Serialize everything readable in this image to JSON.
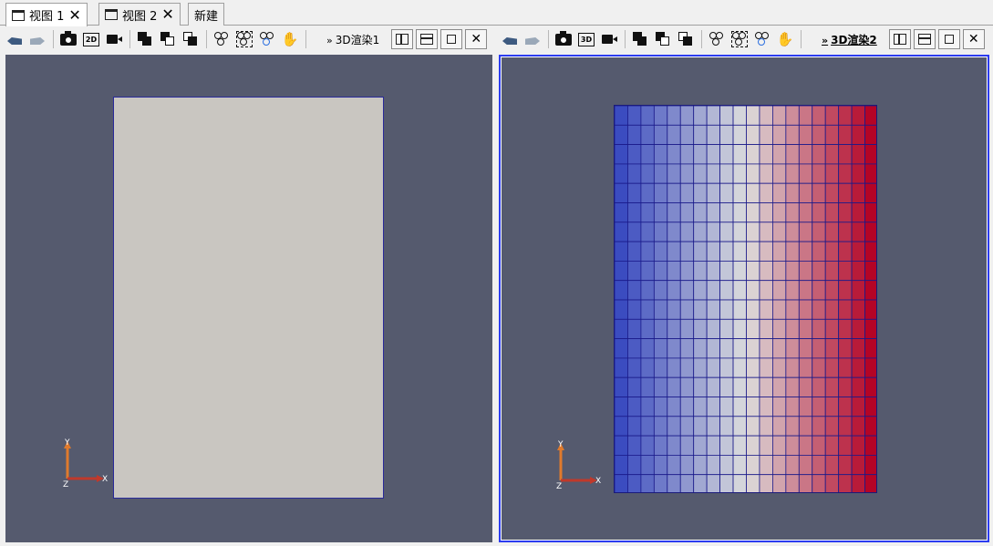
{
  "tabs": [
    {
      "label": "视图 1",
      "closable": true,
      "active": true
    },
    {
      "label": "视图 2",
      "closable": true,
      "active": false
    },
    {
      "label": "新建",
      "closable": false,
      "active": false
    }
  ],
  "toolbar": {
    "twod_label": "2D",
    "chevron": "»",
    "close_glyph": "✕"
  },
  "views": [
    {
      "label": "3D渲染1",
      "active": false
    },
    {
      "label": "3D渲染2",
      "active": true
    }
  ],
  "axes": {
    "x": "X",
    "y": "Y",
    "z": "Z"
  },
  "colors": {
    "background": "#555a6e",
    "surface": "#c9c6c1",
    "colormap_low": "#3b4cc0",
    "colormap_mid": "#dddddd",
    "colormap_high": "#b40426",
    "edge": "#1a1a8a",
    "active_border": "#2c3cf0"
  },
  "mesh": {
    "columns": 20,
    "rows": 20
  }
}
